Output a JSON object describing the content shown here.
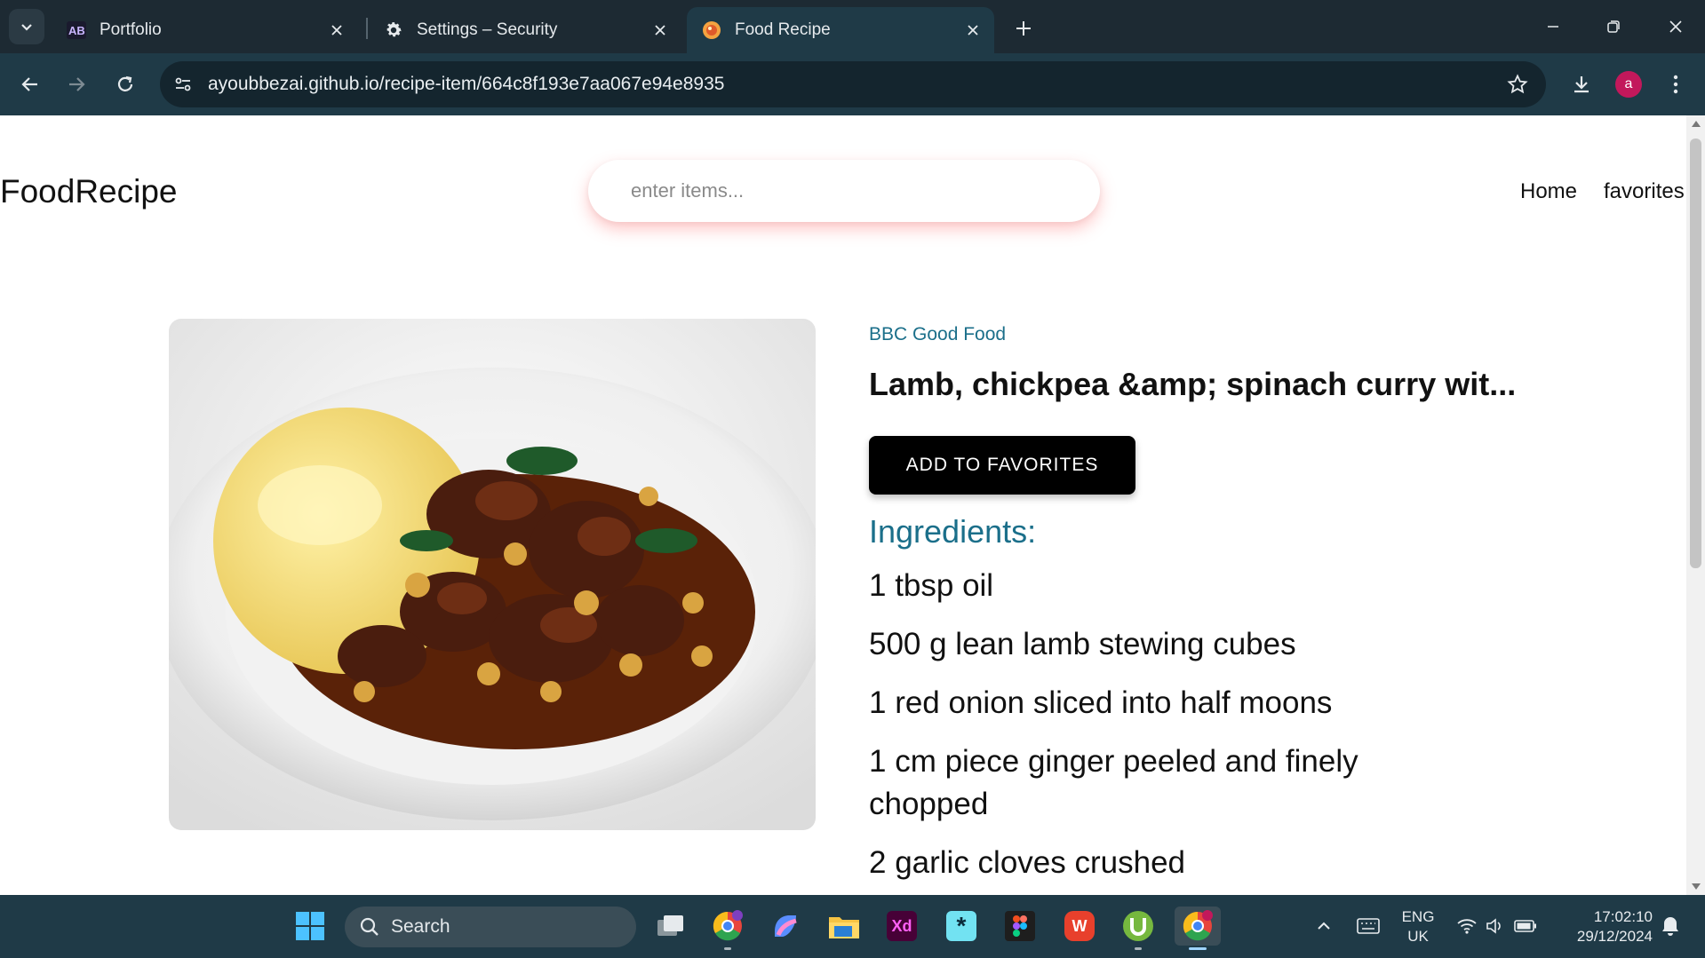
{
  "browser": {
    "tabs": [
      {
        "title": "Portfolio",
        "icon": "ab-logo-icon"
      },
      {
        "title": "Settings – Security",
        "icon": "gear-icon"
      },
      {
        "title": "Food Recipe",
        "icon": "food-favicon-icon"
      }
    ],
    "url": "ayoubbezai.github.io/recipe-item/664c8f193e7aa067e94e8935",
    "profile_initial": "a"
  },
  "site": {
    "logo": "FoodRecipe",
    "search_placeholder": "enter items...",
    "nav": {
      "home": "Home",
      "favorites": "favorites"
    }
  },
  "recipe": {
    "publisher": "BBC Good Food",
    "title": "Lamb, chickpea &amp; spinach curry wit...",
    "add_button": "ADD TO FAVORITES",
    "ingredients_heading": "Ingredients:",
    "ingredients": [
      "1 tbsp oil",
      "500 g lean lamb stewing cubes",
      "1 red onion sliced into half moons",
      "1 cm piece ginger peeled and finely chopped",
      "2 garlic cloves crushed"
    ]
  },
  "taskbar": {
    "search_label": "Search",
    "lang_line1": "ENG",
    "lang_line2": "UK",
    "time": "17:02:10",
    "date": "29/12/2024"
  },
  "colors": {
    "accent": "#1b6f8a",
    "chrome_dark": "#1d2a33",
    "chrome_toolbar": "#1f3a47"
  }
}
